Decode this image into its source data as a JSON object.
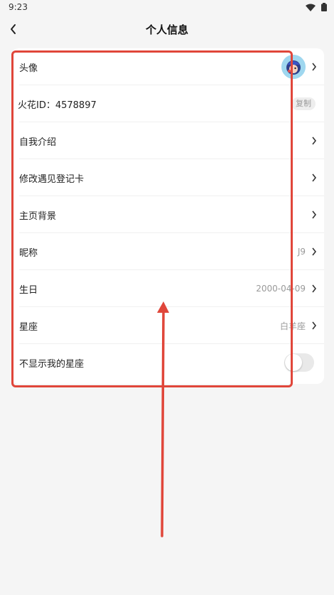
{
  "status": {
    "time": "9:23"
  },
  "header": {
    "title": "个人信息"
  },
  "rows": [
    {
      "label": "头像"
    },
    {
      "label": "火花ID：4578897",
      "action": "复制"
    },
    {
      "label": "自我介绍"
    },
    {
      "label": "修改遇见登记卡"
    },
    {
      "label": "主页背景"
    },
    {
      "label": "昵称",
      "value": "J9"
    },
    {
      "label": "生日",
      "value": "2000-04-09"
    },
    {
      "label": "星座",
      "value": "白羊座"
    },
    {
      "label": "不显示我的星座",
      "toggle": false
    }
  ],
  "colors": {
    "annotation": "#e0463a",
    "accent": "#9fd7ef"
  }
}
